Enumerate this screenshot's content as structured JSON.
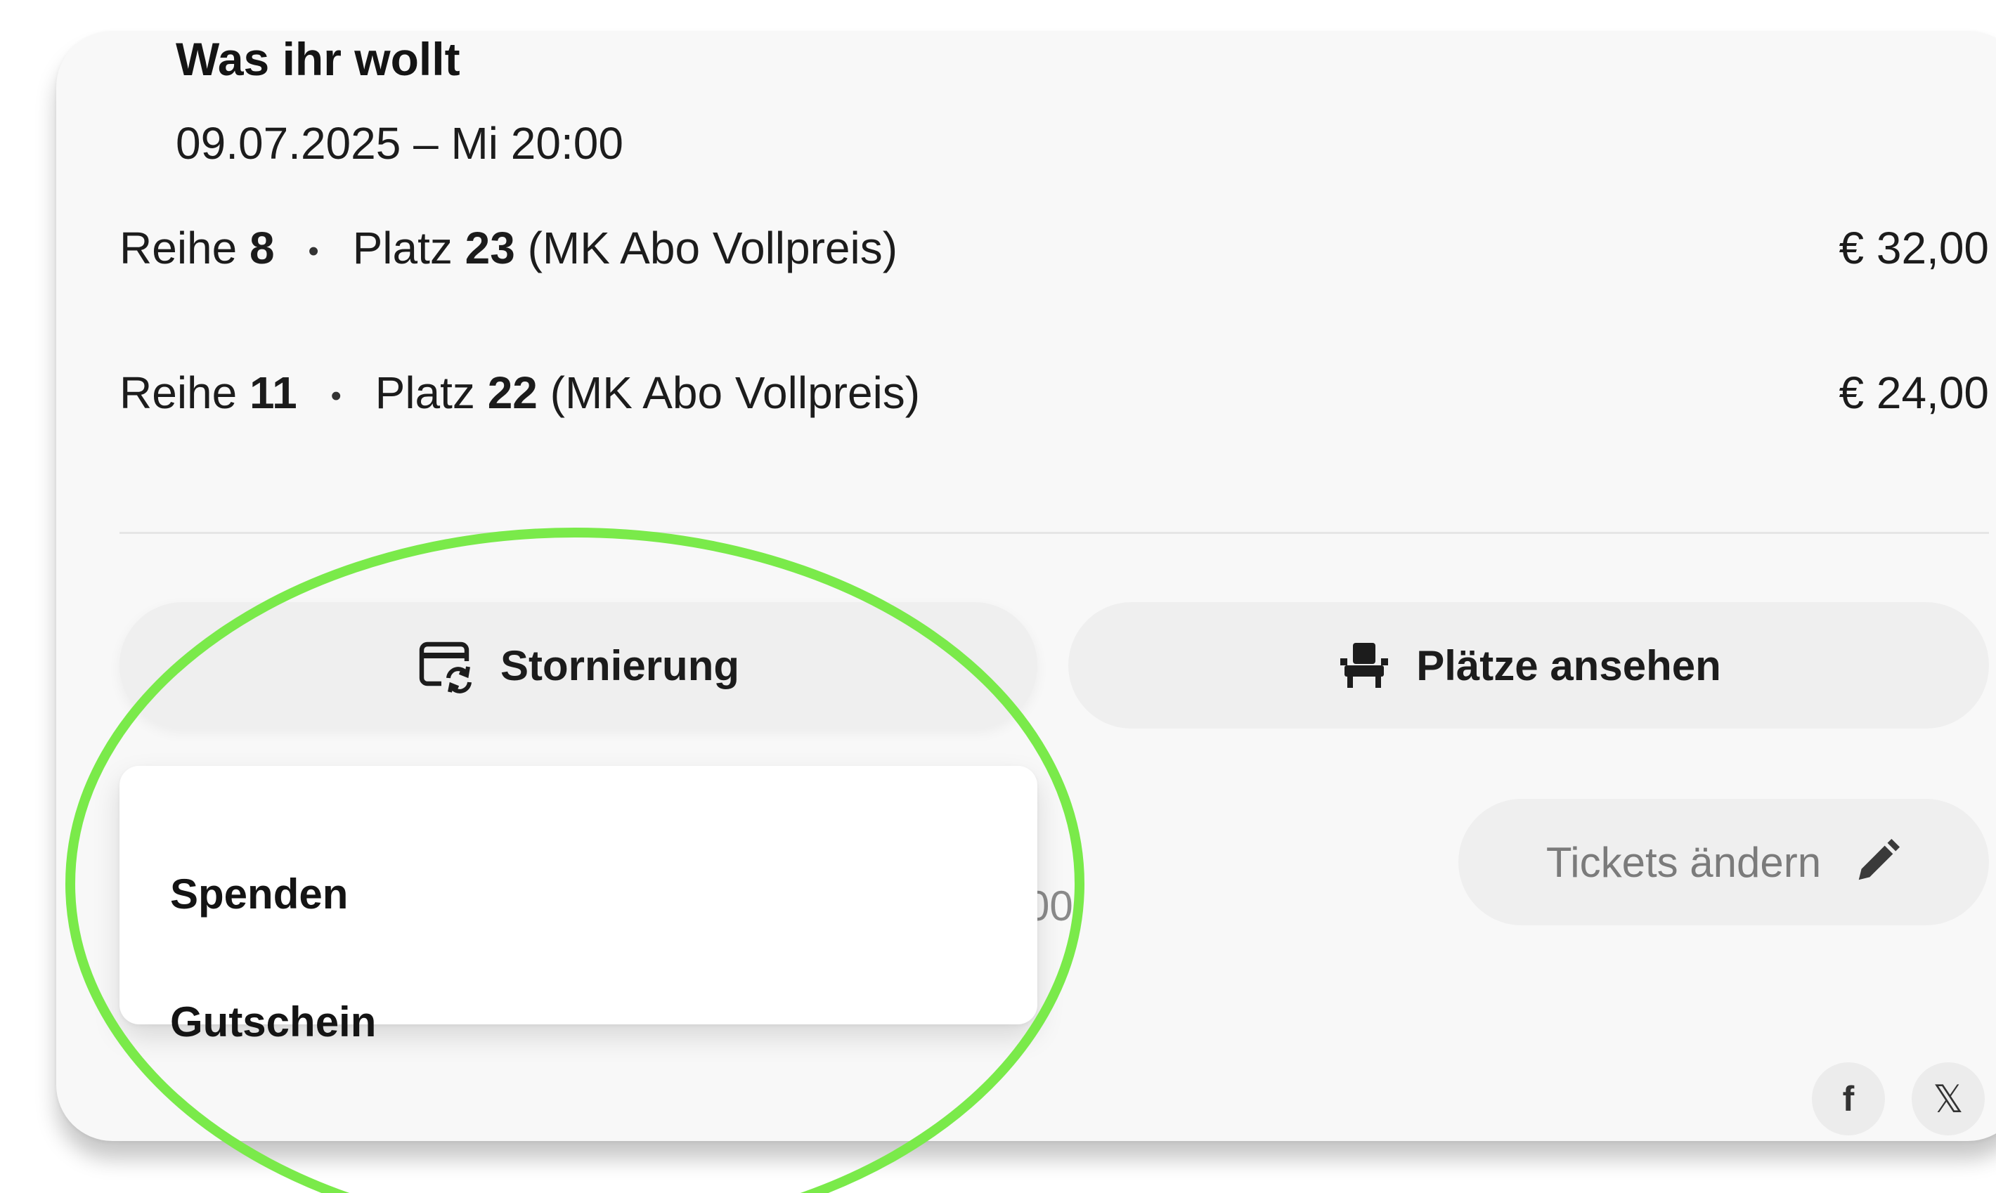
{
  "event": {
    "title": "Was ihr wollt",
    "datetime": "09.07.2025 – Mi 20:00"
  },
  "tickets": [
    {
      "row_label": "Reihe",
      "row": "8",
      "separator": "•",
      "seat_label": "Platz",
      "seat": "23",
      "category": "(MK Abo Vollpreis)",
      "price": "€ 32,00"
    },
    {
      "row_label": "Reihe",
      "row": "11",
      "separator": "•",
      "seat_label": "Platz",
      "seat": "22",
      "category": "(MK Abo Vollpreis)",
      "price": "€ 24,00"
    }
  ],
  "actions": {
    "cancellation": {
      "label": "Stornierung",
      "icon": "card-refresh-icon"
    },
    "view_seats": {
      "label": "Plätze ansehen",
      "icon": "seat-icon"
    },
    "change_tickets": {
      "label": "Tickets ändern",
      "icon": "pencil-icon"
    }
  },
  "dropdown": {
    "items": [
      {
        "label": "Spenden"
      },
      {
        "label": "Gutschein"
      }
    ]
  },
  "partially_hidden_text": "00",
  "social": [
    {
      "label": "f",
      "icon": "facebook-icon"
    },
    {
      "label": "𝕏",
      "icon": "x-icon"
    }
  ],
  "colors": {
    "annotation": "#7aea4a",
    "card_background": "#f8f8f8",
    "pill_background": "#efefef"
  }
}
